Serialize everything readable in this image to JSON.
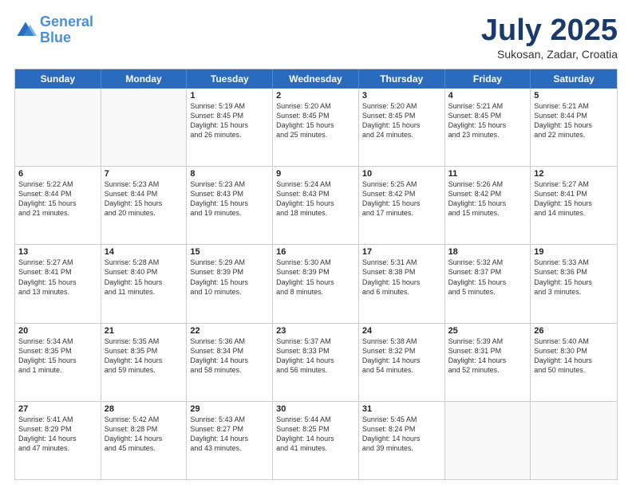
{
  "logo": {
    "line1": "General",
    "line2": "Blue"
  },
  "header": {
    "title": "July 2025",
    "subtitle": "Sukosan, Zadar, Croatia"
  },
  "weekdays": [
    "Sunday",
    "Monday",
    "Tuesday",
    "Wednesday",
    "Thursday",
    "Friday",
    "Saturday"
  ],
  "weeks": [
    [
      {
        "day": "",
        "info": ""
      },
      {
        "day": "",
        "info": ""
      },
      {
        "day": "1",
        "info": "Sunrise: 5:19 AM\nSunset: 8:45 PM\nDaylight: 15 hours\nand 26 minutes."
      },
      {
        "day": "2",
        "info": "Sunrise: 5:20 AM\nSunset: 8:45 PM\nDaylight: 15 hours\nand 25 minutes."
      },
      {
        "day": "3",
        "info": "Sunrise: 5:20 AM\nSunset: 8:45 PM\nDaylight: 15 hours\nand 24 minutes."
      },
      {
        "day": "4",
        "info": "Sunrise: 5:21 AM\nSunset: 8:45 PM\nDaylight: 15 hours\nand 23 minutes."
      },
      {
        "day": "5",
        "info": "Sunrise: 5:21 AM\nSunset: 8:44 PM\nDaylight: 15 hours\nand 22 minutes."
      }
    ],
    [
      {
        "day": "6",
        "info": "Sunrise: 5:22 AM\nSunset: 8:44 PM\nDaylight: 15 hours\nand 21 minutes."
      },
      {
        "day": "7",
        "info": "Sunrise: 5:23 AM\nSunset: 8:44 PM\nDaylight: 15 hours\nand 20 minutes."
      },
      {
        "day": "8",
        "info": "Sunrise: 5:23 AM\nSunset: 8:43 PM\nDaylight: 15 hours\nand 19 minutes."
      },
      {
        "day": "9",
        "info": "Sunrise: 5:24 AM\nSunset: 8:43 PM\nDaylight: 15 hours\nand 18 minutes."
      },
      {
        "day": "10",
        "info": "Sunrise: 5:25 AM\nSunset: 8:42 PM\nDaylight: 15 hours\nand 17 minutes."
      },
      {
        "day": "11",
        "info": "Sunrise: 5:26 AM\nSunset: 8:42 PM\nDaylight: 15 hours\nand 15 minutes."
      },
      {
        "day": "12",
        "info": "Sunrise: 5:27 AM\nSunset: 8:41 PM\nDaylight: 15 hours\nand 14 minutes."
      }
    ],
    [
      {
        "day": "13",
        "info": "Sunrise: 5:27 AM\nSunset: 8:41 PM\nDaylight: 15 hours\nand 13 minutes."
      },
      {
        "day": "14",
        "info": "Sunrise: 5:28 AM\nSunset: 8:40 PM\nDaylight: 15 hours\nand 11 minutes."
      },
      {
        "day": "15",
        "info": "Sunrise: 5:29 AM\nSunset: 8:39 PM\nDaylight: 15 hours\nand 10 minutes."
      },
      {
        "day": "16",
        "info": "Sunrise: 5:30 AM\nSunset: 8:39 PM\nDaylight: 15 hours\nand 8 minutes."
      },
      {
        "day": "17",
        "info": "Sunrise: 5:31 AM\nSunset: 8:38 PM\nDaylight: 15 hours\nand 6 minutes."
      },
      {
        "day": "18",
        "info": "Sunrise: 5:32 AM\nSunset: 8:37 PM\nDaylight: 15 hours\nand 5 minutes."
      },
      {
        "day": "19",
        "info": "Sunrise: 5:33 AM\nSunset: 8:36 PM\nDaylight: 15 hours\nand 3 minutes."
      }
    ],
    [
      {
        "day": "20",
        "info": "Sunrise: 5:34 AM\nSunset: 8:35 PM\nDaylight: 15 hours\nand 1 minute."
      },
      {
        "day": "21",
        "info": "Sunrise: 5:35 AM\nSunset: 8:35 PM\nDaylight: 14 hours\nand 59 minutes."
      },
      {
        "day": "22",
        "info": "Sunrise: 5:36 AM\nSunset: 8:34 PM\nDaylight: 14 hours\nand 58 minutes."
      },
      {
        "day": "23",
        "info": "Sunrise: 5:37 AM\nSunset: 8:33 PM\nDaylight: 14 hours\nand 56 minutes."
      },
      {
        "day": "24",
        "info": "Sunrise: 5:38 AM\nSunset: 8:32 PM\nDaylight: 14 hours\nand 54 minutes."
      },
      {
        "day": "25",
        "info": "Sunrise: 5:39 AM\nSunset: 8:31 PM\nDaylight: 14 hours\nand 52 minutes."
      },
      {
        "day": "26",
        "info": "Sunrise: 5:40 AM\nSunset: 8:30 PM\nDaylight: 14 hours\nand 50 minutes."
      }
    ],
    [
      {
        "day": "27",
        "info": "Sunrise: 5:41 AM\nSunset: 8:29 PM\nDaylight: 14 hours\nand 47 minutes."
      },
      {
        "day": "28",
        "info": "Sunrise: 5:42 AM\nSunset: 8:28 PM\nDaylight: 14 hours\nand 45 minutes."
      },
      {
        "day": "29",
        "info": "Sunrise: 5:43 AM\nSunset: 8:27 PM\nDaylight: 14 hours\nand 43 minutes."
      },
      {
        "day": "30",
        "info": "Sunrise: 5:44 AM\nSunset: 8:25 PM\nDaylight: 14 hours\nand 41 minutes."
      },
      {
        "day": "31",
        "info": "Sunrise: 5:45 AM\nSunset: 8:24 PM\nDaylight: 14 hours\nand 39 minutes."
      },
      {
        "day": "",
        "info": ""
      },
      {
        "day": "",
        "info": ""
      }
    ]
  ]
}
